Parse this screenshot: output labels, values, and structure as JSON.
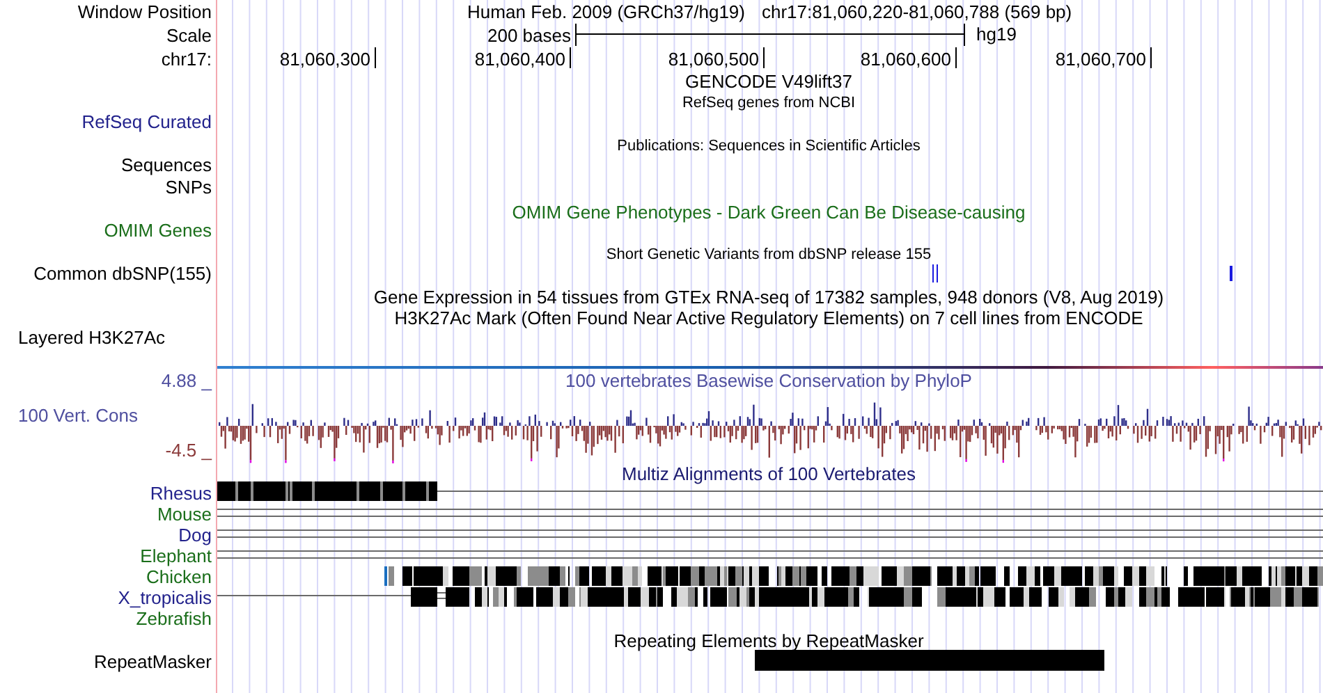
{
  "header": {
    "window_position": {
      "label": "Window Position",
      "assembly": "Human Feb. 2009 (GRCh37/hg19)",
      "position": "chr17:81,060,220-81,060,788 (569 bp)"
    },
    "scale": {
      "label": "Scale",
      "length": "200 bases",
      "assembly": "hg19"
    },
    "ruler": {
      "label": "chr17:",
      "ticks": [
        "81,060,300",
        "81,060,400",
        "81,060,500",
        "81,060,600",
        "81,060,700"
      ]
    }
  },
  "track_labels": [
    {
      "label": "RefSeq Curated",
      "color": "#22228c"
    },
    {
      "label": "Sequences",
      "color": "#000000"
    },
    {
      "label": "SNPs",
      "color": "#000000"
    },
    {
      "label": "OMIM Genes",
      "color": "#1a6e1a"
    },
    {
      "label": "Common dbSNP(155)",
      "color": "#000000"
    },
    {
      "label": "Layered H3K27Ac",
      "color": "#000000"
    }
  ],
  "track_titles": [
    {
      "text": "GENCODE V49lift37",
      "color": "#000000"
    },
    {
      "text": "RefSeq genes from NCBI",
      "color": "#000000"
    },
    {
      "text": "Publications: Sequences in Scientific Articles",
      "color": "#000000"
    },
    {
      "text": "OMIM Gene Phenotypes - Dark Green Can Be Disease-causing",
      "color": "#1a6e1a"
    },
    {
      "text": "Short Genetic Variants from dbSNP release 155",
      "color": "#000000"
    },
    {
      "text": "Gene Expression in 54 tissues from GTEx RNA-seq of 17382 samples, 948 donors (V8, Aug 2019)",
      "color": "#000000"
    },
    {
      "text": "H3K27Ac Mark (Often Found Near Active Regulatory Elements) on 7 cell lines from ENCODE",
      "color": "#000000"
    }
  ],
  "conservation": {
    "label": "100 Vert. Cons",
    "max": "4.88 _",
    "min": "-4.5 _",
    "title": "100 vertebrates Basewise Conservation by PhyloP"
  },
  "multiz": {
    "title": "Multiz Alignments of 100 Vertebrates",
    "species": [
      {
        "name": "Rhesus",
        "color": "#22228c",
        "kind": "partial"
      },
      {
        "name": "Mouse",
        "color": "#1a6e1a",
        "kind": "double-line"
      },
      {
        "name": "Dog",
        "color": "#22228c",
        "kind": "double-line"
      },
      {
        "name": "Elephant",
        "color": "#1a6e1a",
        "kind": "double-line"
      },
      {
        "name": "Chicken",
        "color": "#1a6e1a",
        "kind": "dense"
      },
      {
        "name": "X_tropicalis",
        "color": "#22228c",
        "kind": "dense-with-line"
      },
      {
        "name": "Zebrafish",
        "color": "#1a6e1a",
        "kind": "none"
      }
    ]
  },
  "repeatmasker": {
    "label": "RepeatMasker",
    "title": "Repeating Elements by RepeatMasker"
  }
}
